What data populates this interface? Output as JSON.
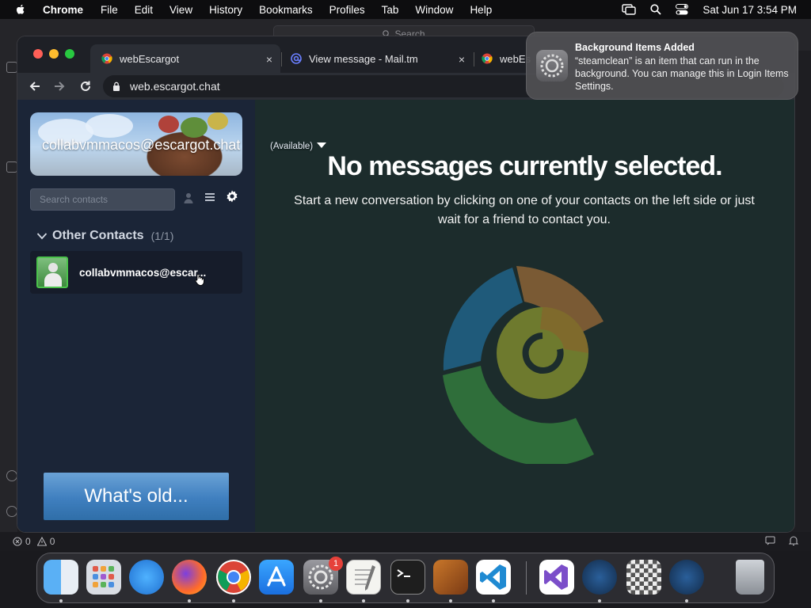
{
  "menubar": {
    "app": "Chrome",
    "items": [
      "File",
      "Edit",
      "View",
      "History",
      "Bookmarks",
      "Profiles",
      "Tab",
      "Window",
      "Help"
    ],
    "datetime": "Sat Jun 17  3:54 PM",
    "icons": [
      "apple-icon",
      "screen-mirroring-icon",
      "spotlight-search-icon",
      "control-center-icon"
    ]
  },
  "bgapp": {
    "search_label": "Search",
    "status_errors": "0",
    "status_warnings": "0"
  },
  "browser": {
    "tabs": [
      {
        "title": "webEscargot",
        "active": true,
        "close": "×"
      },
      {
        "title": "View message - Mail.tm",
        "active": false,
        "close": "×"
      },
      {
        "title": "webEs",
        "active": false
      }
    ],
    "url": "web.escargot.chat"
  },
  "sidebar": {
    "username": "collabvmmacos@escargot.chat",
    "status": "(Available)",
    "search_placeholder": "Search contacts",
    "group": {
      "name": "Other Contacts",
      "count": "(1/1)"
    },
    "contacts": [
      {
        "name": "collabvmmacos@escar..."
      }
    ],
    "whats_old": "What's old..."
  },
  "main": {
    "title": "No messages currently selected.",
    "subtitle": "Start a new conversation by clicking on one of your contacts on the left side or just wait for a friend to contact you."
  },
  "notification": {
    "title": "Background Items Added",
    "body": "“steamclean” is an item that can run in the background. You can manage this in Login Items Settings."
  },
  "dock": {
    "apps": [
      "finder",
      "launchpad",
      "safari",
      "firefox",
      "chrome",
      "app-store",
      "system-settings",
      "textedit",
      "terminal",
      "garageband",
      "vscode",
      "visual-studio",
      "steam",
      "chess",
      "steam-2",
      "trash"
    ],
    "badge": "1"
  },
  "colors": {
    "accent_blue": "#3f7fbf",
    "logo_blue": "#1f5a7a",
    "logo_orange": "#8a5a2e",
    "logo_olive": "#6e7a2e",
    "logo_green": "#2f6e3a"
  }
}
